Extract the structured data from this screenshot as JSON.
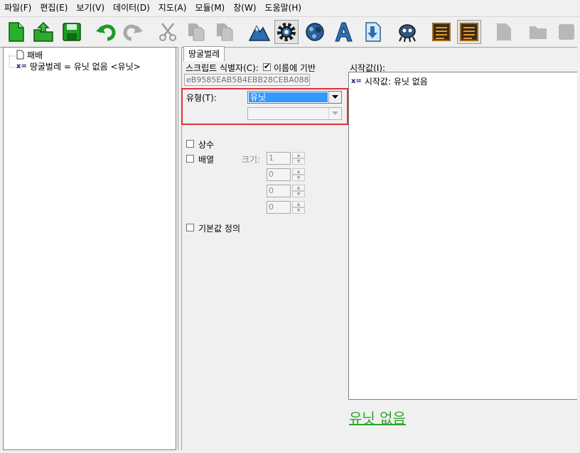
{
  "menu": [
    "파일(F)",
    "편집(E)",
    "보기(V)",
    "데이터(D)",
    "지도(A)",
    "모듈(M)",
    "창(W)",
    "도움말(H)"
  ],
  "toolbar": {
    "buttons": [
      {
        "name": "new-file-button",
        "icon": "new-file-icon"
      },
      {
        "name": "open-file-button",
        "icon": "open-folder-icon"
      },
      {
        "name": "save-button",
        "icon": "floppy-disk-icon"
      },
      {
        "name": "undo-button",
        "icon": "undo-arrow-icon"
      },
      {
        "name": "redo-button",
        "icon": "redo-arrow-icon"
      },
      {
        "name": "cut-button",
        "icon": "scissors-icon"
      },
      {
        "name": "copy-button",
        "icon": "copy-icon"
      },
      {
        "name": "paste-button",
        "icon": "paste-icon"
      },
      {
        "name": "terrain-editor-button",
        "icon": "mountain-icon"
      },
      {
        "name": "trigger-editor-button",
        "icon": "gear-icon"
      },
      {
        "name": "unit-editor-button",
        "icon": "unit-icon"
      },
      {
        "name": "ai-editor-button",
        "icon": "letter-a-icon"
      },
      {
        "name": "import-button",
        "icon": "import-arrow-icon"
      },
      {
        "name": "object-editor-button",
        "icon": "creature-icon"
      },
      {
        "name": "text-editor-button",
        "icon": "list-icon"
      },
      {
        "name": "data-editor-button",
        "icon": "list-icon"
      },
      {
        "name": "document-button",
        "icon": "document-icon"
      },
      {
        "name": "folder-button",
        "icon": "folder-icon"
      },
      {
        "name": "square-button",
        "icon": "square-icon"
      }
    ]
  },
  "tree": {
    "items": [
      {
        "label": "패배",
        "icon": "document-icon"
      },
      {
        "label": "땅굴벌레 = 유닛 없음 <유닛>",
        "icon": "variable-icon",
        "prefix": "x="
      }
    ]
  },
  "detail": {
    "tab": "땅굴벌레",
    "script_id_label": "스크립트 식별자(C):",
    "name_based_label": "이름에 기반",
    "name_based_checked": true,
    "script_id_value": "eB9585EAB5B4EBB28CEBA088",
    "type_label": "유형(T):",
    "type_value": "유닛",
    "subtype_value": "",
    "constant_label": "상수",
    "array_label": "배열",
    "size_label": "크기:",
    "size_values": [
      "1",
      "0",
      "0",
      "0"
    ],
    "default_label": "기본값 정의"
  },
  "initial": {
    "label": "시작값(I):",
    "prefix": "x=",
    "item": "시작값: 유닛 없음",
    "link_text": "유닛 없음"
  },
  "colors": {
    "highlight": "#e0303a",
    "selection": "#3399ff",
    "link": "#2ea52e"
  }
}
